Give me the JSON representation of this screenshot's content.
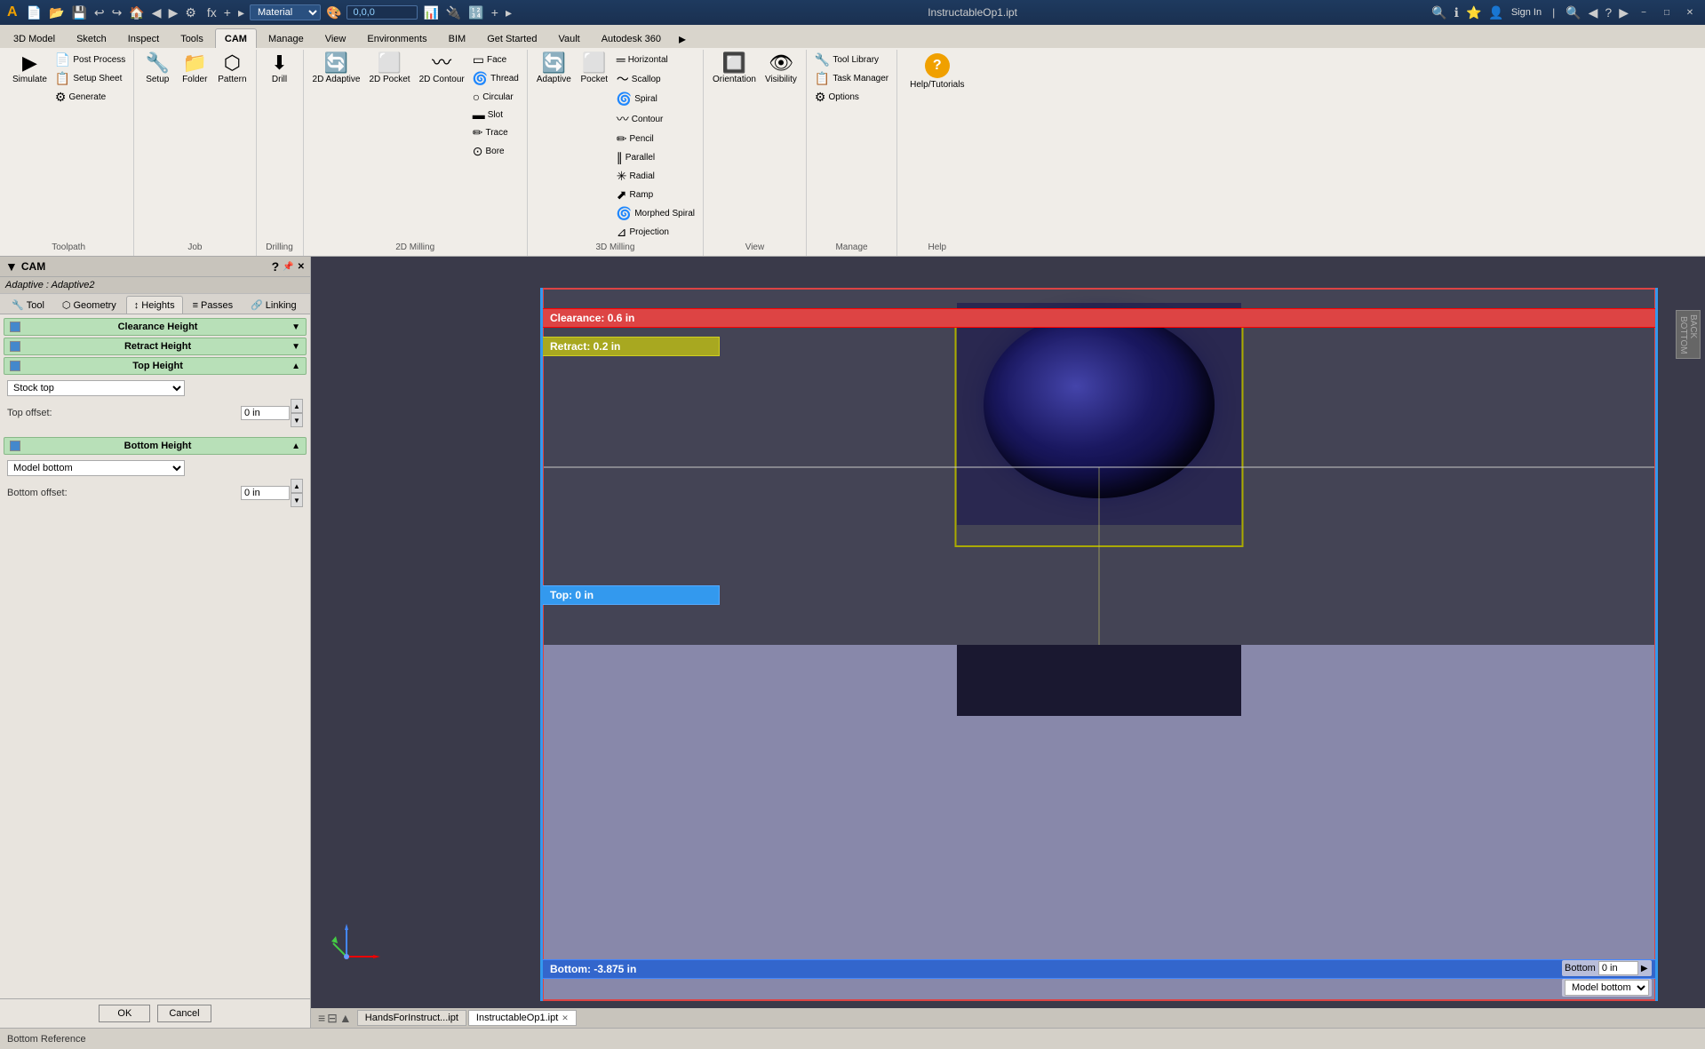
{
  "titlebar": {
    "app_icon": "A",
    "filename": "InstructableOp1.ipt",
    "minimize": "−",
    "maximize": "□",
    "close": "✕",
    "material_label": "Material",
    "coords": "0,0,0"
  },
  "ribbon": {
    "tabs": [
      "3D Model",
      "Sketch",
      "Inspect",
      "Tools",
      "CAM",
      "Manage",
      "View",
      "Environments",
      "BIM",
      "Get Started",
      "Vault",
      "Autodesk 360"
    ],
    "active_tab": "CAM",
    "groups": {
      "toolpath": {
        "label": "Toolpath",
        "simulate_label": "Simulate",
        "post_process_label": "Post Process",
        "setup_sheet_label": "Setup Sheet",
        "generate_label": "Generate"
      },
      "job": {
        "label": "Job",
        "setup_label": "Setup",
        "folder_label": "Folder",
        "pattern_label": "Pattern"
      },
      "drilling": {
        "label": "Drilling",
        "drill_label": "Drill"
      },
      "milling2d": {
        "label": "2D Milling",
        "adaptive_label": "2D Adaptive",
        "pocket_label": "2D Pocket",
        "contour_label": "2D Contour",
        "face_label": "Face",
        "thread_label": "Thread",
        "circular_label": "Circular",
        "slot_label": "Slot",
        "trace_label": "Trace",
        "bore_label": "Bore"
      },
      "milling3d": {
        "label": "3D Milling",
        "adaptive_label": "Adaptive",
        "pocket_label": "Pocket",
        "horizontal_label": "Horizontal",
        "scallop_label": "Scallop",
        "spiral_label": "Spiral",
        "contour_label": "Contour",
        "pencil_label": "Pencil",
        "parallel_label": "Parallel",
        "radial_label": "Radial",
        "ramp_label": "Ramp",
        "morphed_spiral_label": "Morphed Spiral",
        "projection_label": "Projection"
      },
      "view": {
        "label": "View",
        "orientation_label": "Orientation",
        "visibility_label": "Visibility"
      },
      "manage": {
        "label": "Manage",
        "tool_library_label": "Tool Library",
        "task_manager_label": "Task Manager",
        "options_label": "Options"
      },
      "help": {
        "label": "Help",
        "help_tutorials_label": "Help/Tutorials"
      }
    }
  },
  "cam_panel": {
    "title": "CAM",
    "adaptive_subtitle": "Adaptive : Adaptive2",
    "tabs": [
      "Tool",
      "Geometry",
      "Heights",
      "Passes",
      "Linking"
    ],
    "active_tab": "Heights",
    "sections": {
      "clearance_height": {
        "label": "Clearance Height",
        "expanded": false
      },
      "retract_height": {
        "label": "Retract Height",
        "expanded": false
      },
      "top_height": {
        "label": "Top Height",
        "expanded": true,
        "from_label": "Stock top",
        "offset_label": "Top offset:",
        "offset_value": "0 in"
      },
      "bottom_height": {
        "label": "Bottom Height",
        "expanded": true,
        "from_label": "Model bottom",
        "offset_label": "Bottom offset:",
        "offset_value": "0 in"
      }
    },
    "buttons": {
      "ok": "OK",
      "cancel": "Cancel"
    }
  },
  "viewport": {
    "clearance_label": "Clearance: 0.6 in",
    "retract_label": "Retract: 0.2 in",
    "top_label": "Top: 0 in",
    "bottom_label": "Bottom: -3.875 in",
    "bottom_input": "0 in",
    "bottom_dropdown": "Model bottom",
    "back_label": "BACK BOTTOM"
  },
  "status_bar": {
    "text": "Bottom Reference"
  },
  "viewport_tabs": [
    {
      "label": "HandsForInstruct...ipt",
      "active": false
    },
    {
      "label": "InstructableOp1.ipt",
      "active": true
    }
  ],
  "nav_icons": [
    "≡",
    "⊟",
    "▲"
  ]
}
